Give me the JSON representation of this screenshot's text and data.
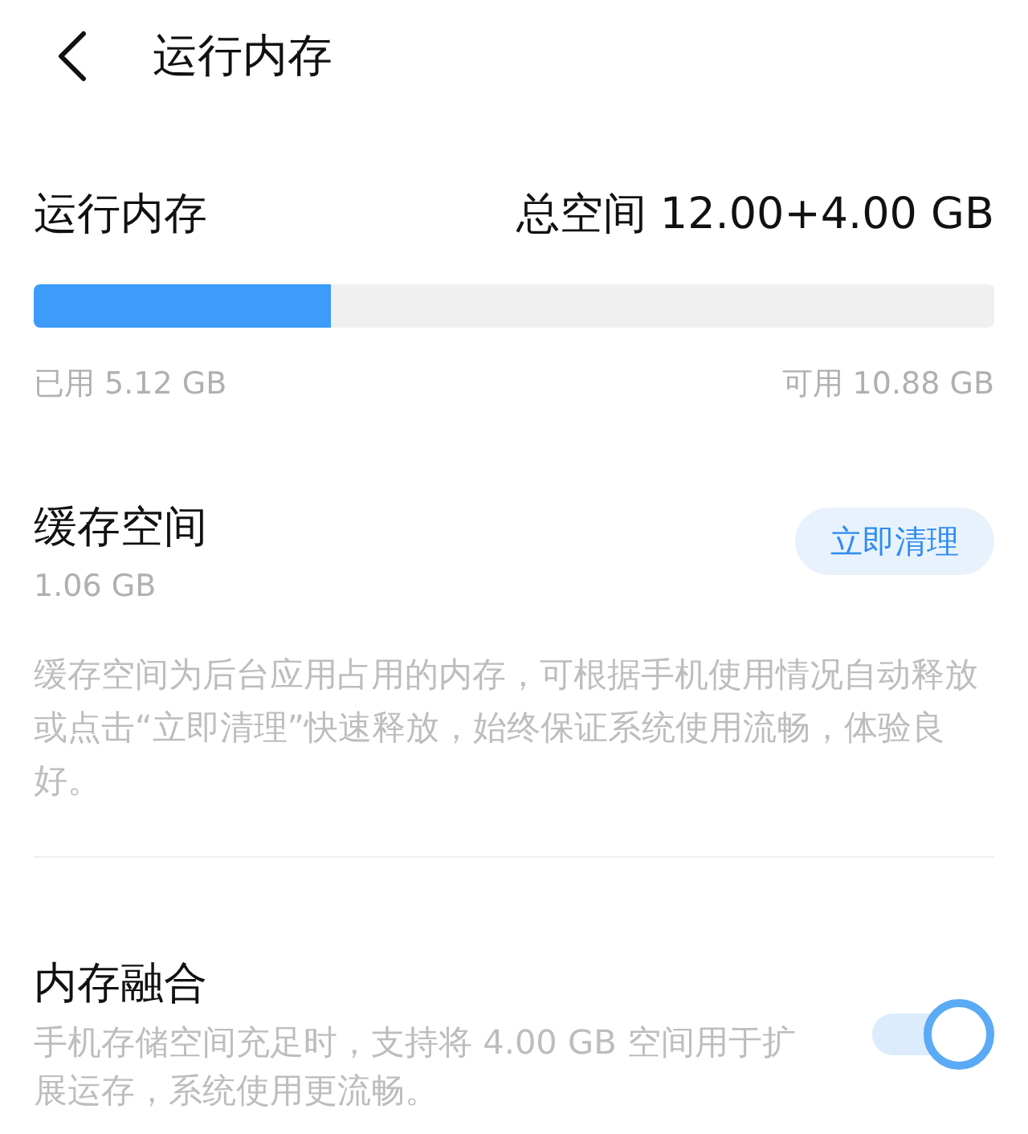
{
  "header": {
    "title": "运行内存"
  },
  "memory": {
    "title": "运行内存",
    "total": "总空间 12.00+4.00 GB",
    "level": 0.31,
    "used": "已用 5.12 GB",
    "available": "可用 10.88 GB"
  },
  "cache": {
    "title": "缓存空间",
    "size": "1.06 GB",
    "button": "立即清理",
    "description": "缓存空间为后台应用占用的内存，可根据手机使用情况自动释放或点击“立即清理”快速释放，始终保证系统使用流畅，体验良好。"
  },
  "fusion": {
    "title": "内存融合",
    "description": "手机存储空间充足时，支持将 4.00 GB 空间用于扩展运存，系统使用更流畅。",
    "on": true
  }
}
